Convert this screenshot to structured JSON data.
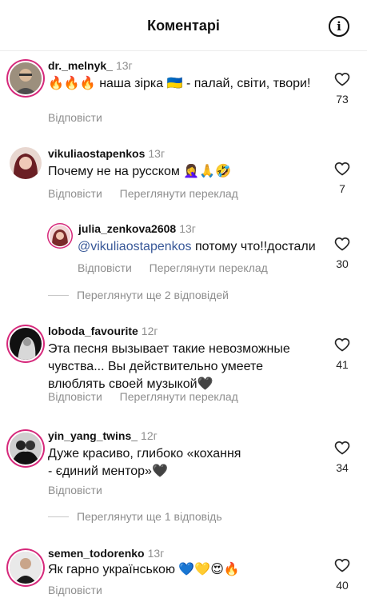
{
  "header": {
    "title": "Коментарі"
  },
  "comments": [
    {
      "username": "dr._melnyk_",
      "time": "13г",
      "text": "🔥🔥🔥 наша зірка 🇺🇦 - палай, світи, твори!",
      "reply": "Відповісти",
      "likes": "73"
    },
    {
      "username": "vikuliaostapenkos",
      "time": "13г",
      "text": "Почему не на русском 🤦‍♀️🙏🤣",
      "reply": "Відповісти",
      "translate": "Переглянути переклад",
      "likes": "7"
    },
    {
      "username": "julia_zenkova2608",
      "time": "13г",
      "mention": "@vikuliaostapenkos",
      "text": " потому что!!достали",
      "reply": "Відповісти",
      "translate": "Переглянути переклад",
      "likes": "30"
    },
    {
      "username": "loboda_favourite",
      "time": "12г",
      "text": "Эта песня вызывает такие невозможные чувства... Вы действительно умеете влюблять своей музыкой🖤",
      "reply": "Відповісти",
      "translate": "Переглянути переклад",
      "likes": "41"
    },
    {
      "username": "yin_yang_twins_",
      "time": "12г",
      "text": "Дуже красиво, глибоко «кохання - єдиний ментор»🖤",
      "reply": "Відповісти",
      "likes": "34"
    },
    {
      "username": "semen_todorenko",
      "time": "13г",
      "text": "Як гарно українською 💙💛😍🔥",
      "reply": "Відповісти",
      "likes": "40"
    }
  ],
  "view_more": [
    "Переглянути ще 2 відповідей",
    "Переглянути ще 1 відповідь"
  ],
  "icons": {
    "info": "info-icon",
    "like": "heart-icon"
  },
  "colors": {
    "text": "#111111",
    "muted": "#8e8e8e",
    "mention": "#385898",
    "ring": "#d6297b"
  }
}
